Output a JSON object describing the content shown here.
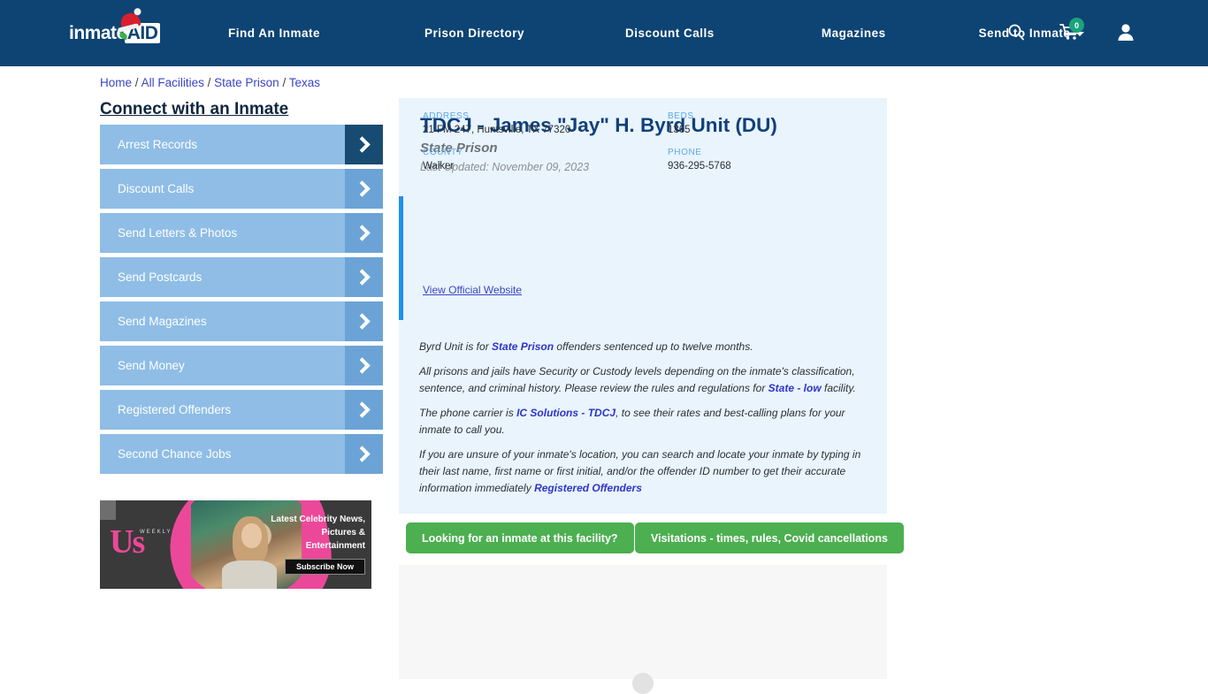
{
  "header": {
    "logo_text_1": "inmate",
    "logo_text_2": "AID",
    "nav": [
      {
        "label": "Find An Inmate"
      },
      {
        "label": "Prison Directory"
      },
      {
        "label": "Discount Calls"
      },
      {
        "label": "Magazines"
      },
      {
        "label": "Send to Inmate"
      }
    ],
    "cart_count": "0",
    "colors": {
      "bar": "#0d4474",
      "badge": "#1ba37c"
    }
  },
  "breadcrumb": {
    "home": "Home",
    "sep": "/",
    "all_facilities": "All Facilities",
    "state_prison": "State Prison",
    "texas": "Texas"
  },
  "sidebar": {
    "title": "Connect with an Inmate",
    "items": [
      {
        "label": "Arrest Records"
      },
      {
        "label": "Discount Calls"
      },
      {
        "label": "Send Letters & Photos"
      },
      {
        "label": "Send Postcards"
      },
      {
        "label": "Send Magazines"
      },
      {
        "label": "Send Money"
      },
      {
        "label": "Registered Offenders"
      },
      {
        "label": "Second Chance Jobs"
      }
    ]
  },
  "ad": {
    "brand": "Us",
    "brand_sub": "WEEKLY",
    "headline": "Latest Celebrity News, Pictures & Entertainment",
    "cta": "Subscribe Now"
  },
  "facility": {
    "title": "TDCJ - James \"Jay\" H. Byrd Unit (DU)",
    "subtitle": "State Prison",
    "last_updated": "Last Updated: November 09, 2023",
    "fields": {
      "address_label": "ADDRESS",
      "address_value": "21 FM 247, Huntsville, TX 77320",
      "beds_label": "BEDS",
      "beds_value": "1365",
      "county_label": "COUNTY",
      "county_value": "Walker",
      "phone_label": "PHONE",
      "phone_value": "936-295-5768"
    },
    "official_website_link": "View Official Website",
    "description": {
      "p1_a": "Byrd Unit is for ",
      "p1_link": "State Prison",
      "p1_b": " offenders sentenced up to twelve months.",
      "p2_a": "All prisons and jails have Security or Custody levels depending on the inmate's classification, sentence, and criminal history. Please review the rules and regulations for ",
      "p2_link": "State - low",
      "p2_b": " facility.",
      "p3_a": "The phone carrier is ",
      "p3_link": "IC Solutions - TDCJ",
      "p3_b": ", to see their rates and best-calling plans for your inmate to call you.",
      "p4_a": "If you are unsure of your inmate's location, you can search and locate your inmate by typing in their last name, first name or first initial, and/or the offender ID number to get their accurate information immediately ",
      "p4_link": "Registered Offenders"
    }
  },
  "actions": {
    "find_inmate": "Looking for an inmate at this facility?",
    "visitations": "Visitations - times, rules, Covid cancellations",
    "green": "#4caf50"
  }
}
